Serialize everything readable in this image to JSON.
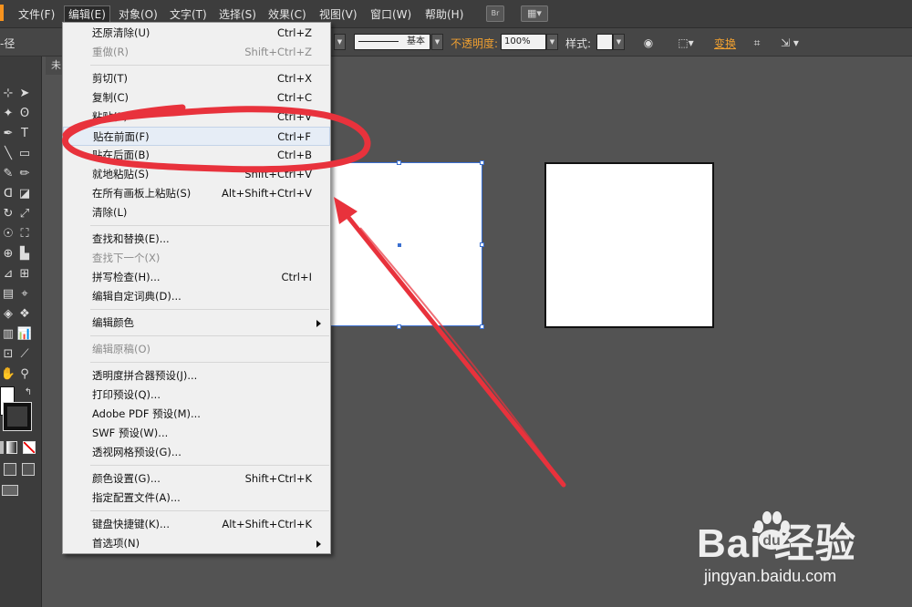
{
  "menubar": {
    "items": [
      {
        "label": "文件(F)",
        "name": "menu-file"
      },
      {
        "label": "编辑(E)",
        "name": "menu-edit",
        "active": true
      },
      {
        "label": "对象(O)",
        "name": "menu-object"
      },
      {
        "label": "文字(T)",
        "name": "menu-type"
      },
      {
        "label": "选择(S)",
        "name": "menu-select"
      },
      {
        "label": "效果(C)",
        "name": "menu-effect"
      },
      {
        "label": "视图(V)",
        "name": "menu-view"
      },
      {
        "label": "窗口(W)",
        "name": "menu-window"
      },
      {
        "label": "帮助(H)",
        "name": "menu-help"
      }
    ],
    "bridge_label": "Br"
  },
  "controlbar": {
    "left_label": "-径",
    "stroke_profile": "基本",
    "opacity_label": "不透明度:",
    "opacity_value": "100%",
    "style_label": "样式:",
    "transform_label": "变换"
  },
  "document": {
    "tab_label": "未"
  },
  "edit_menu": {
    "sections": [
      [
        {
          "label": "还原清除(U)",
          "shortcut": "Ctrl+Z"
        },
        {
          "label": "重做(R)",
          "shortcut": "Shift+Ctrl+Z",
          "disabled": true
        }
      ],
      [
        {
          "label": "剪切(T)",
          "shortcut": "Ctrl+X"
        },
        {
          "label": "复制(C)",
          "shortcut": "Ctrl+C"
        },
        {
          "label": "粘贴(P)",
          "shortcut": "Ctrl+V"
        },
        {
          "label": "贴在前面(F)",
          "shortcut": "Ctrl+F",
          "highlighted": true
        },
        {
          "label": "贴在后面(B)",
          "shortcut": "Ctrl+B"
        },
        {
          "label": "就地粘贴(S)",
          "shortcut": "Shift+Ctrl+V"
        },
        {
          "label": "在所有画板上粘贴(S)",
          "shortcut": "Alt+Shift+Ctrl+V"
        },
        {
          "label": "清除(L)",
          "shortcut": ""
        }
      ],
      [
        {
          "label": "查找和替换(E)...",
          "shortcut": ""
        },
        {
          "label": "查找下一个(X)",
          "shortcut": "",
          "disabled": true
        },
        {
          "label": "拼写检查(H)...",
          "shortcut": "Ctrl+I"
        },
        {
          "label": "编辑自定词典(D)...",
          "shortcut": ""
        }
      ],
      [
        {
          "label": "编辑颜色",
          "shortcut": "",
          "submenu": true
        }
      ],
      [
        {
          "label": "编辑原稿(O)",
          "shortcut": "",
          "disabled": true
        }
      ],
      [
        {
          "label": "透明度拼合器预设(J)...",
          "shortcut": ""
        },
        {
          "label": "打印预设(Q)...",
          "shortcut": ""
        },
        {
          "label": "Adobe PDF 预设(M)...",
          "shortcut": ""
        },
        {
          "label": "SWF 预设(W)...",
          "shortcut": ""
        },
        {
          "label": "透视网格预设(G)...",
          "shortcut": ""
        }
      ],
      [
        {
          "label": "颜色设置(G)...",
          "shortcut": "Shift+Ctrl+K"
        },
        {
          "label": "指定配置文件(A)...",
          "shortcut": ""
        }
      ],
      [
        {
          "label": "键盘快捷键(K)...",
          "shortcut": "Alt+Shift+Ctrl+K"
        },
        {
          "label": "首选项(N)",
          "shortcut": "",
          "submenu": true
        }
      ]
    ]
  },
  "watermark": {
    "logo_text": "Bai  经验",
    "site": "jingyan.baidu.com"
  },
  "colors": {
    "annotation_red": "#e8323c",
    "selection_blue": "#3a6fd0",
    "menu_highlight": "#e6edf6"
  }
}
